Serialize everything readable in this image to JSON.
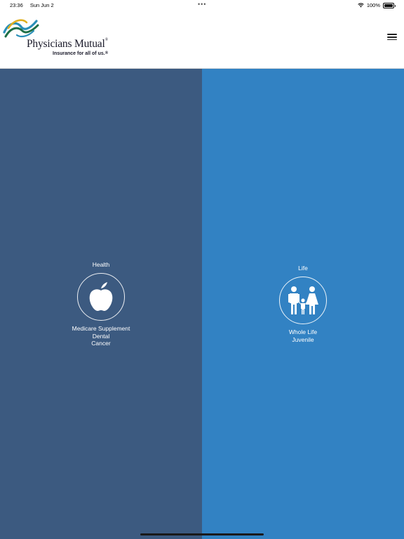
{
  "status_bar": {
    "time": "23:36",
    "date": "Sun Jun 2",
    "battery": "100%"
  },
  "header": {
    "brand_name": "Physicians Mutual",
    "brand_reg": "®",
    "tagline": "Insurance for all of us.",
    "tagline_reg": "®"
  },
  "panels": [
    {
      "title": "Health",
      "icon": "apple-icon",
      "color": "#3c5a80",
      "items": [
        "Medicare Supplement",
        "Dental",
        "Cancer"
      ]
    },
    {
      "title": "Life",
      "icon": "family-icon",
      "color": "#3282c3",
      "items": [
        "Whole Life",
        "Juvenile"
      ]
    }
  ]
}
